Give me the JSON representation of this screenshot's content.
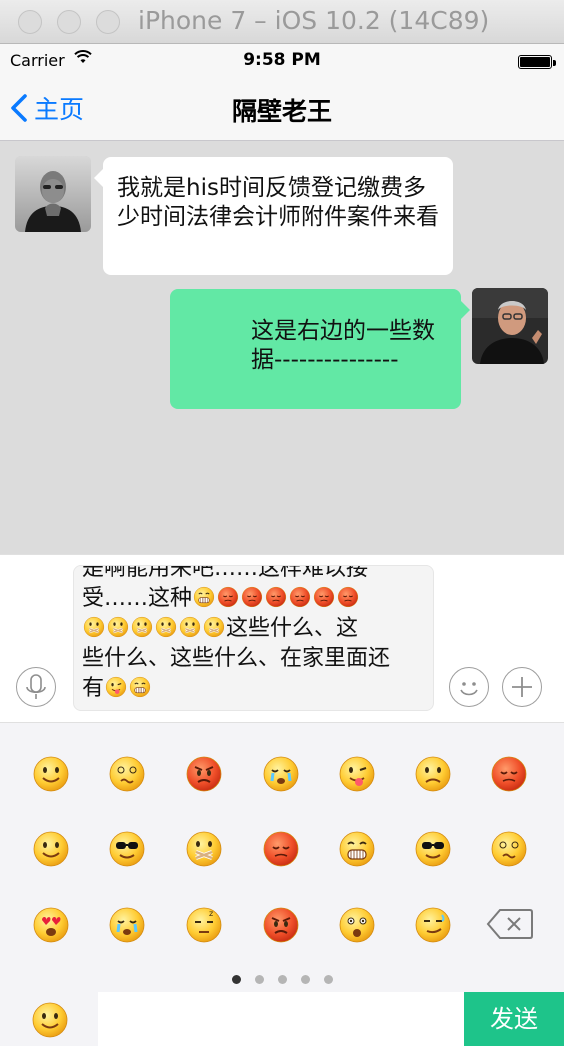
{
  "window": {
    "title": "iPhone 7 – iOS 10.2 (14C89)"
  },
  "status": {
    "carrier": "Carrier",
    "time": "9:58 PM"
  },
  "nav": {
    "back_label": "主页",
    "title": "隔壁老王"
  },
  "messages": [
    {
      "side": "left",
      "text": "我就是his时间反馈登记缴费多少时间法律会计师附件案件来看"
    },
    {
      "side": "right",
      "text": "这是右边的一些数据---------------"
    }
  ],
  "input": {
    "line0": "是啊能用来吧……这样难以接",
    "line1": "受……这种",
    "line3": "这些什么、这",
    "line4": "些什么、这些什么、在家里面还",
    "line5": "有"
  },
  "send_label": "发送",
  "colors": {
    "right_bubble": "#62e8a5",
    "send_button": "#1ec48a",
    "accent": "#0a7aff"
  },
  "keyboard": {
    "pages": 5,
    "active_page": 0
  }
}
